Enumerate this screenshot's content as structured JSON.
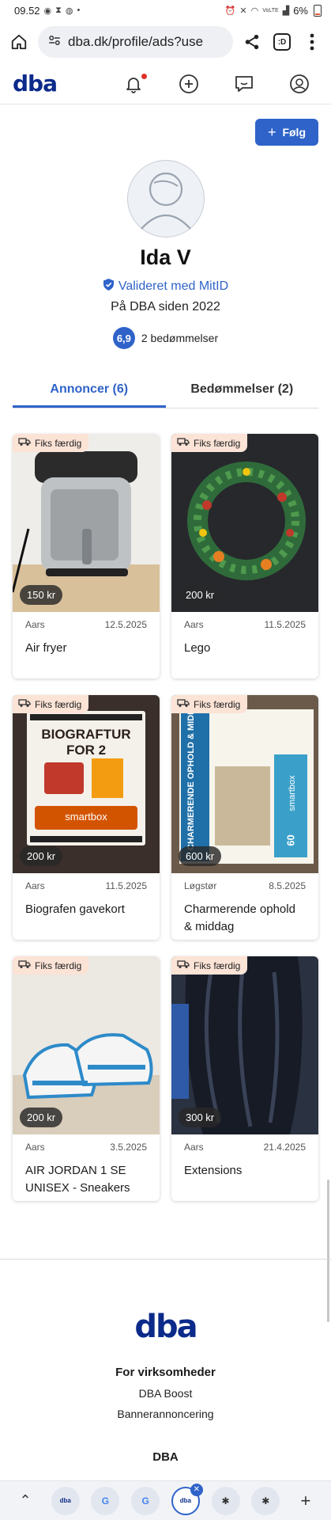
{
  "status": {
    "time": "09.52",
    "battery": "6%",
    "network": "VoLTE"
  },
  "browser": {
    "url": "dba.dk/profile/ads?use",
    "tab_count": ":D"
  },
  "header": {
    "logo": "dba"
  },
  "profile": {
    "follow_label": "Følg",
    "name": "Ida V",
    "verified": "Valideret med MitID",
    "since": "På DBA siden 2022",
    "rating_value": "6,9",
    "rating_count": "2 bedømmelser"
  },
  "tabs": [
    {
      "label": "Annoncer (6)",
      "active": true
    },
    {
      "label": "Bedømmelser (2)",
      "active": false
    }
  ],
  "listings": [
    {
      "badge": "Fiks færdig",
      "price": "150 kr",
      "location": "Aars",
      "date": "12.5.2025",
      "title": "Air fryer"
    },
    {
      "badge": "Fiks færdig",
      "price": "200 kr",
      "location": "Aars",
      "date": "11.5.2025",
      "title": "Lego"
    },
    {
      "badge": "Fiks færdig",
      "price": "200 kr",
      "location": "Aars",
      "date": "11.5.2025",
      "title": "Biografen gavekort"
    },
    {
      "badge": "Fiks færdig",
      "price": "600 kr",
      "location": "Løgstør",
      "date": "8.5.2025",
      "title": "Charmerende ophold & middag"
    },
    {
      "badge": "Fiks færdig",
      "price": "200 kr",
      "location": "Aars",
      "date": "3.5.2025",
      "title": "AIR JORDAN 1 SE UNISEX - Sneakers"
    },
    {
      "badge": "Fiks færdig",
      "price": "300 kr",
      "location": "Aars",
      "date": "21.4.2025",
      "title": "Extensions"
    }
  ],
  "listing_images": {
    "box1_line1": "BIOGRAFTUR",
    "box1_line2": "FOR 2",
    "box1_brand": "smartbox",
    "box2_side": "CHARMERENDE OPHOLD & MIDDAG",
    "box2_brand": "smartbox",
    "box2_count": "60"
  },
  "footer": {
    "logo": "dba",
    "section1": "For virksomheder",
    "link1": "DBA Boost",
    "link2": "Bannerannoncering",
    "section2": "DBA"
  },
  "colors": {
    "brand": "#0b2a8a",
    "accent": "#2f63c9",
    "badge": "#fbe3d6"
  }
}
